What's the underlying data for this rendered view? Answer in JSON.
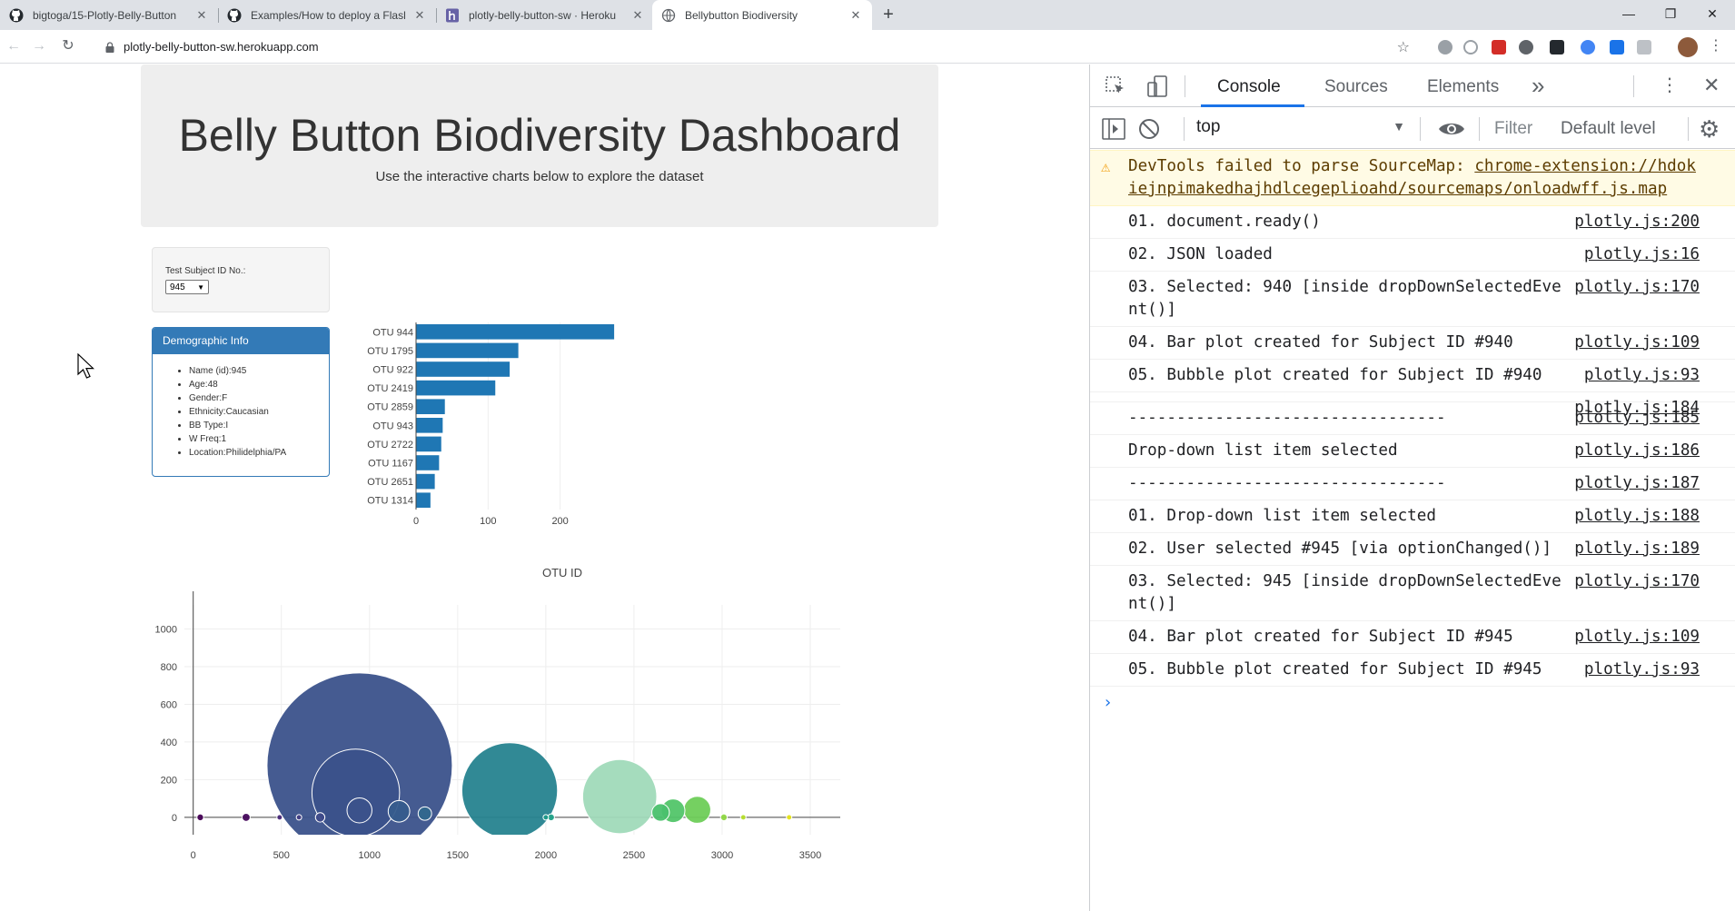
{
  "browser": {
    "tabs": [
      {
        "title": "bigtoga/15-Plotly-Belly-Button",
        "icon": "github-icon",
        "active": false
      },
      {
        "title": "Examples/How to deploy a Flask",
        "icon": "github-icon",
        "active": false
      },
      {
        "title": "plotly-belly-button-sw · Heroku",
        "icon": "heroku-icon",
        "active": false
      },
      {
        "title": "Bellybutton Biodiversity",
        "icon": "globe-icon",
        "active": true
      }
    ],
    "new_tab": "+",
    "url": "plotly-belly-button-sw.herokuapp.com"
  },
  "page": {
    "title": "Belly Button Biodiversity Dashboard",
    "subtitle": "Use the interactive charts below to explore the dataset",
    "selector_label": "Test Subject ID No.:",
    "selected_id": "945",
    "demo_heading": "Demographic Info",
    "demographics": [
      "Name (id):945",
      "Age:48",
      "Gender:F",
      "Ethnicity:Caucasian",
      "BB Type:I",
      "W Freq:1",
      "Location:Philidelphia/PA"
    ]
  },
  "chart_data": [
    {
      "type": "bar",
      "orientation": "horizontal",
      "categories": [
        "OTU 944",
        "OTU 1795",
        "OTU 922",
        "OTU 2419",
        "OTU 2859",
        "OTU 943",
        "OTU 2722",
        "OTU 1167",
        "OTU 2651",
        "OTU 1314"
      ],
      "values": [
        275,
        142,
        130,
        110,
        40,
        37,
        35,
        32,
        26,
        20
      ],
      "xticks": [
        0,
        100,
        200
      ],
      "xlim": [
        0,
        290
      ],
      "color": "#1f77b4"
    },
    {
      "type": "scatter",
      "style": "bubble",
      "title": "OTU ID",
      "xticks": [
        0,
        500,
        1000,
        1500,
        2000,
        2500,
        3000,
        3500
      ],
      "yticks": [
        0,
        200,
        400,
        600,
        800,
        1000
      ],
      "xlim": [
        -50,
        3670
      ],
      "ylim": [
        -150,
        1200
      ],
      "points": [
        {
          "x": 40,
          "y": 0,
          "size": 10,
          "color": "#440154"
        },
        {
          "x": 300,
          "y": 0,
          "size": 12,
          "color": "#46085c"
        },
        {
          "x": 490,
          "y": 0,
          "size": 4,
          "color": "#482979"
        },
        {
          "x": 600,
          "y": 0,
          "size": 4,
          "color": "#433e85"
        },
        {
          "x": 944,
          "y": 275,
          "size": 275,
          "color": "#3b528b"
        },
        {
          "x": 922,
          "y": 130,
          "size": 130,
          "color": "#3b528b"
        },
        {
          "x": 943,
          "y": 37,
          "size": 37,
          "color": "#3b528b"
        },
        {
          "x": 720,
          "y": 0,
          "size": 14,
          "color": "#3e4a89"
        },
        {
          "x": 1167,
          "y": 32,
          "size": 32,
          "color": "#365c8d"
        },
        {
          "x": 1314,
          "y": 20,
          "size": 20,
          "color": "#31688e"
        },
        {
          "x": 1795,
          "y": 142,
          "size": 142,
          "color": "#26838f"
        },
        {
          "x": 2000,
          "y": 0,
          "size": 6,
          "color": "#1f9a8a"
        },
        {
          "x": 2030,
          "y": 0,
          "size": 10,
          "color": "#1fa187"
        },
        {
          "x": 2419,
          "y": 110,
          "size": 110,
          "color": "#a0dab9"
        },
        {
          "x": 2651,
          "y": 26,
          "size": 26,
          "color": "#4ac16d"
        },
        {
          "x": 2722,
          "y": 35,
          "size": 35,
          "color": "#52c569"
        },
        {
          "x": 2859,
          "y": 40,
          "size": 40,
          "color": "#6ece58"
        },
        {
          "x": 3010,
          "y": 0,
          "size": 10,
          "color": "#8fd744"
        },
        {
          "x": 3120,
          "y": 0,
          "size": 6,
          "color": "#b5de2b"
        },
        {
          "x": 3380,
          "y": 0,
          "size": 4,
          "color": "#e6e419"
        }
      ]
    }
  ],
  "devtools": {
    "tabs": [
      {
        "label": "Console",
        "active": true
      },
      {
        "label": "Sources",
        "active": false
      },
      {
        "label": "Elements",
        "active": false
      }
    ],
    "more": "»",
    "context": "top",
    "filter_placeholder": "Filter",
    "level": "Default level",
    "warning": {
      "text": "DevTools failed to parse SourceMap: ",
      "link": "chrome-extension://hdokiejnpimakedhajhdlcegeplioahd/sourcemaps/onloadwff.js.map"
    },
    "messages": [
      {
        "text": "01. document.ready()",
        "source": "plotly.js:200"
      },
      {
        "text": "02. JSON loaded",
        "source": "plotly.js:16"
      },
      {
        "text": "03. Selected: 940 [inside dropDownSelectedEvent()]",
        "source": "plotly.js:170"
      },
      {
        "text": "04. Bar plot created for Subject ID #940",
        "source": "plotly.js:109"
      },
      {
        "text": "05. Bubble plot created for Subject ID #940",
        "source": "plotly.js:93"
      },
      {
        "text": "",
        "source": "plotly.js:184"
      },
      {
        "text": "---------------------------------",
        "source": "plotly.js:185"
      },
      {
        "text": "Drop-down list item selected",
        "source": "plotly.js:186"
      },
      {
        "text": "---------------------------------",
        "source": "plotly.js:187"
      },
      {
        "text": "01. Drop-down list item selected",
        "source": "plotly.js:188"
      },
      {
        "text": "02. User selected #945 [via optionChanged()]",
        "source": "plotly.js:189"
      },
      {
        "text": "03. Selected: 945 [inside dropDownSelectedEvent()]",
        "source": "plotly.js:170"
      },
      {
        "text": "04. Bar plot created for Subject ID #945",
        "source": "plotly.js:109"
      },
      {
        "text": "05. Bubble plot created for Subject ID #945",
        "source": "plotly.js:93"
      }
    ],
    "prompt": "›"
  }
}
